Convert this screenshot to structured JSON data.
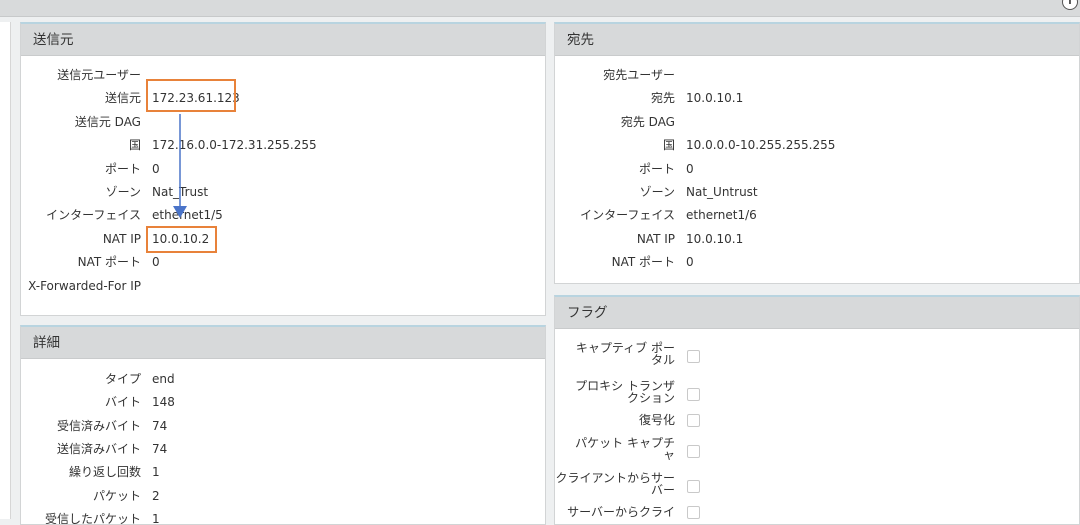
{
  "source": {
    "title": "送信元",
    "rows": [
      {
        "label": "送信元ユーザー",
        "value": ""
      },
      {
        "label": "送信元",
        "value": "172.23.61.123"
      },
      {
        "label": "送信元 DAG",
        "value": ""
      },
      {
        "label": "国",
        "value": "172.16.0.0-172.31.255.255"
      },
      {
        "label": "ポート",
        "value": "0"
      },
      {
        "label": "ゾーン",
        "value": "Nat_Trust"
      },
      {
        "label": "インターフェイス",
        "value": "ethernet1/5"
      },
      {
        "label": "NAT IP",
        "value": "10.0.10.2"
      },
      {
        "label": "NAT ポート",
        "value": "0"
      },
      {
        "label": "X-Forwarded-For IP",
        "value": ""
      }
    ]
  },
  "destination": {
    "title": "宛先",
    "rows": [
      {
        "label": "宛先ユーザー",
        "value": ""
      },
      {
        "label": "宛先",
        "value": "10.0.10.1"
      },
      {
        "label": "宛先 DAG",
        "value": ""
      },
      {
        "label": "国",
        "value": "10.0.0.0-10.255.255.255"
      },
      {
        "label": "ポート",
        "value": "0"
      },
      {
        "label": "ゾーン",
        "value": "Nat_Untrust"
      },
      {
        "label": "インターフェイス",
        "value": "ethernet1/6"
      },
      {
        "label": "NAT IP",
        "value": "10.0.10.1"
      },
      {
        "label": "NAT ポート",
        "value": "0"
      }
    ]
  },
  "details": {
    "title": "詳細",
    "rows": [
      {
        "label": "タイプ",
        "value": "end"
      },
      {
        "label": "バイト",
        "value": "148"
      },
      {
        "label": "受信済みバイト",
        "value": "74"
      },
      {
        "label": "送信済みバイト",
        "value": "74"
      },
      {
        "label": "繰り返し回数",
        "value": "1"
      },
      {
        "label": "パケット",
        "value": "2"
      },
      {
        "label": "受信したパケット",
        "value": "1"
      }
    ]
  },
  "flags": {
    "title": "フラグ",
    "items": [
      {
        "line1": "キャプティブ ポー",
        "line2": "タル"
      },
      {
        "line1": "プロキシ トランザ",
        "line2": "クション"
      },
      {
        "line1": "復号化",
        "line2": ""
      },
      {
        "line1": "パケット キャプチ",
        "line2": "ャ"
      },
      {
        "line1": "クライアントからサー",
        "line2": "バー"
      },
      {
        "line1": "サーバーからクライ",
        "line2": ""
      }
    ]
  },
  "colors": {
    "highlight": "#e8823a",
    "arrow": "#4a74c9"
  },
  "icons": {
    "help": "help-icon"
  }
}
